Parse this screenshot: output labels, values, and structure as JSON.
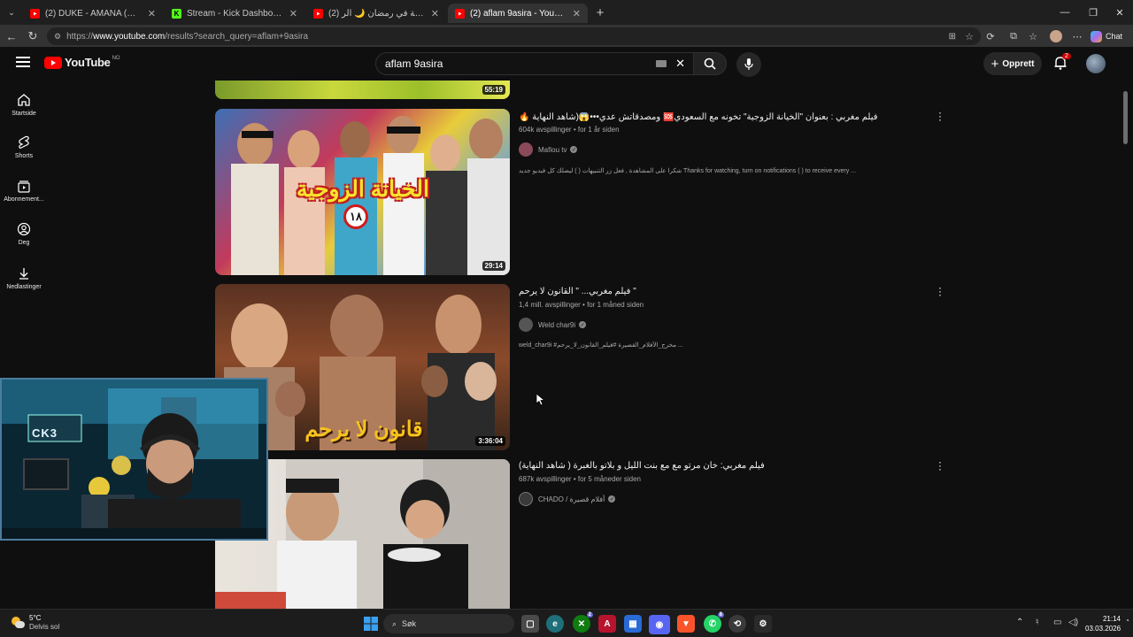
{
  "browser": {
    "tabs": [
      {
        "title": "(2) DUKE - AMANA (Official Lyric Vide",
        "icon": "youtube-icon",
        "active": false
      },
      {
        "title": "Stream - Kick Dashboard",
        "icon": "kick-icon",
        "active": false
      },
      {
        "title": "(2) وجبة الضخامة في رمضان 🌙 الر",
        "icon": "youtube-icon",
        "active": false
      },
      {
        "title": "(2) aflam 9asira - YouTube",
        "icon": "youtube-icon",
        "active": true
      }
    ],
    "new_tab": "+",
    "url_prefix": "https://",
    "url_domain": "www.youtube.com",
    "url_path": "/results?search_query=aflam+9asira",
    "chat_label": "Chat"
  },
  "youtube": {
    "logo_text": "YouTube",
    "region": "NO",
    "search_value": "aflam 9asira",
    "create_label": "Opprett",
    "notif_count": "2",
    "sidebar": [
      {
        "label": "Startside",
        "icon": "home-icon"
      },
      {
        "label": "Shorts",
        "icon": "shorts-icon"
      },
      {
        "label": "Abonnement...",
        "icon": "subscriptions-icon"
      },
      {
        "label": "Deg",
        "icon": "you-icon"
      },
      {
        "label": "Nedlastinger",
        "icon": "download-icon"
      }
    ],
    "top_partial_duration": "55:19",
    "results": [
      {
        "title": "🔥 ومصدقاتش عدي•••😱(شاهد النهاية 🆘فيلم مغربي : بعنوان \"الخيانة الزوجية\" تخونه مع السعودي",
        "views": "604k avspillinger",
        "age": "for 1 år siden",
        "channel": "Mafiou tv",
        "description": "شكرا على المشاهدة , فعل زر التنبيهات ( ) ليصلك كل فيديو جديد Thanks for watching, turn on notifications ( ) to receive every ...",
        "duration": "29:14",
        "thumb_text": "الخيانة الزوجية",
        "thumb_badge": "١٨"
      },
      {
        "title": "فيلم مغربي... \" القانون لا يرحم \"",
        "views": "1,4 mill. avspillinger",
        "age": "for 1 måned siden",
        "channel": "Weld char9i",
        "description": "weld_char9i #مخرج_الأفلام_القصيرة #فيلم_القانون_لا_يرحم ...",
        "duration": "3:36:04",
        "thumb_text": "قانون لا يرحم"
      },
      {
        "title": "فيلم مغربي: خان مرتو مع مع بنت الليل و بلاتو بالغبرة ( شاهد النهاية)",
        "views": "687k avspillinger",
        "age": "for 5 måneder siden",
        "channel": "CHADO / أفلام قصيرة",
        "description": "",
        "duration": ""
      }
    ]
  },
  "webcam": {
    "sign": "CK3"
  },
  "taskbar": {
    "weather_temp": "5°C",
    "weather_desc": "Delvis sol",
    "search_label": "Søk",
    "time": "21:14",
    "date": "03.03.2026",
    "badge_xbox": "2",
    "badge_whatsapp": "8"
  },
  "colors": {
    "youtube_red": "#ff0000",
    "kick_green": "#53fc18",
    "bg": "#0f0f0f"
  }
}
